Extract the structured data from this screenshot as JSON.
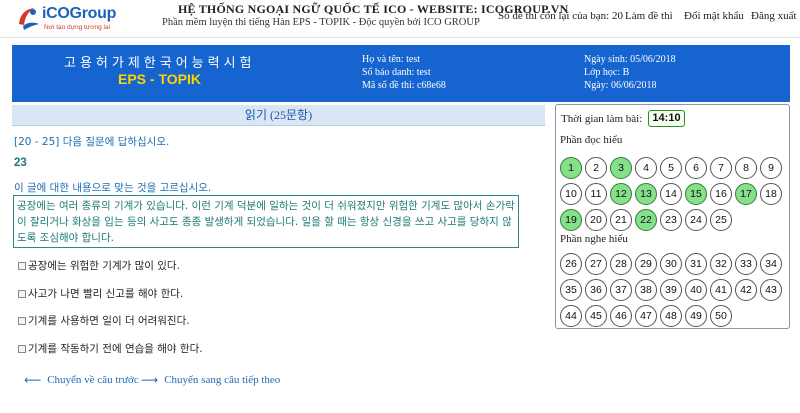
{
  "header": {
    "logo": {
      "brand_a": "iCO",
      "brand_b": "Group",
      "tagline": "Nơi tạo dựng tương lai"
    },
    "title": "HỆ THỐNG NGOẠI NGỮ QUỐC TẾ ICO - WEBSITE: ICOGROUP.VN",
    "subtitle": "Phần mềm luyện thi tiếng Hàn EPS - TOPIK - Độc quyền bởi ICO GROUP",
    "nav": {
      "remaining": "Số đề thi còn lại của bạn: 20",
      "take_exam": "Làm đề thi",
      "change_password": "Đổi mật khẩu",
      "logout": "Đăng xuất"
    }
  },
  "banner": {
    "korean_title": "고용허가제한국어능력시험",
    "eps": "EPS - TOPIK",
    "name": "Họ và tên: test",
    "id": "Số báo danh: test",
    "exam_code": "Mã số đề thi: c68e68",
    "dob": "Ngày sinh: 05/06/2018",
    "class": "Lớp học: B",
    "today": "Ngày: 06/06/2018"
  },
  "section": {
    "title": "읽기 (25문항)"
  },
  "question": {
    "instruction": "[20 - 25] 다음 질문에 답하십시오.",
    "number": "23",
    "prompt": "이 글에 대한 내용으로 맞는 것을 고르십시오.",
    "passage": "공장에는 여러 종류의 기계가 있습니다. 이런 기계 덕분에 일하는 것이 더 쉬워졌지만 위험한 기계도 많아서 손가락이 잘리거나 화상을 입는 등의 사고도 종종 발생하게 되었습니다. 일을 할 때는 항상 신경을 쓰고 사고를 당하지 않도록 조심해야 합니다.",
    "options": [
      "공장에는 위험한 기계가 많이 있다.",
      "사고가 나면 빨리 신고를 해야 한다.",
      "기계를 사용하면 일이 더 어려워진다.",
      "기계를 작동하기 전에 연습을 해야 한다."
    ],
    "prev": "Chuyển về câu trước",
    "next": "Chuyển sang câu tiếp theo"
  },
  "panel": {
    "timer_label": "Thời gian làm bài:",
    "timer": "14:10",
    "reading_label": "Phần đọc hiểu",
    "listening_label": "Phần nghe hiểu",
    "reading": [
      "1",
      "2",
      "3",
      "4",
      "5",
      "6",
      "7",
      "8",
      "9",
      "10",
      "11",
      "12",
      "13",
      "14",
      "15",
      "16",
      "17",
      "18",
      "19",
      "20",
      "21",
      "22",
      "23",
      "24",
      "25"
    ],
    "reading_done": [
      "1",
      "3",
      "12",
      "13",
      "15",
      "17",
      "19",
      "22"
    ],
    "listening": [
      "26",
      "27",
      "28",
      "29",
      "30",
      "31",
      "32",
      "33",
      "34",
      "35",
      "36",
      "37",
      "38",
      "39",
      "40",
      "41",
      "42",
      "43",
      "44",
      "45",
      "46",
      "47",
      "48",
      "49",
      "50"
    ],
    "listening_done": []
  },
  "colors": {
    "banner": "#1564cf",
    "eps_yellow": "#ffd300",
    "answered": "#86e08a",
    "passage_border": "#2b8a89"
  }
}
